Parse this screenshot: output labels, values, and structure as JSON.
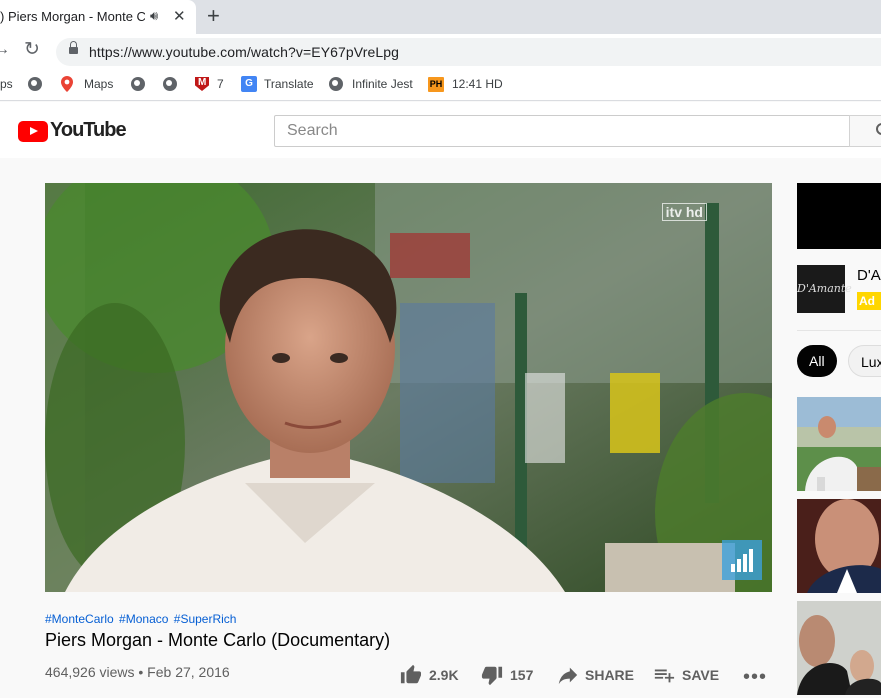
{
  "browser": {
    "tab_title": ") Piers Morgan - Monte Ca",
    "new_tab": "+",
    "url": "https://www.youtube.com/watch?v=EY67pVreLpg",
    "bookmarks": {
      "apps": "ps",
      "maps": "Maps",
      "mcafee_count": "7",
      "translate": "Translate",
      "infinite_jest": "Infinite Jest",
      "ph_icon": "PH",
      "ph": "12:41 HD"
    }
  },
  "youtube": {
    "logo_text": "YouTube",
    "search_placeholder": "Search"
  },
  "player": {
    "watermark": "itv hd"
  },
  "video": {
    "hashtags": [
      "#MonteCarlo",
      "#Monaco",
      "#SuperRich"
    ],
    "title": "Piers Morgan - Monte Carlo (Documentary)",
    "meta": "464,926 views • Feb 27, 2016",
    "likes": "2.9K",
    "dislikes": "157",
    "share": "SHARE",
    "save": "SAVE",
    "more": "•••"
  },
  "sidebar": {
    "ad_logo": "D'Amante",
    "ad_title": "D'A",
    "ad_badge": "Ad",
    "chips": [
      "All",
      "Lux"
    ]
  },
  "colors": {
    "accent": "#ff0000",
    "link": "#065fd4",
    "ad_badge": "#ffd600"
  }
}
